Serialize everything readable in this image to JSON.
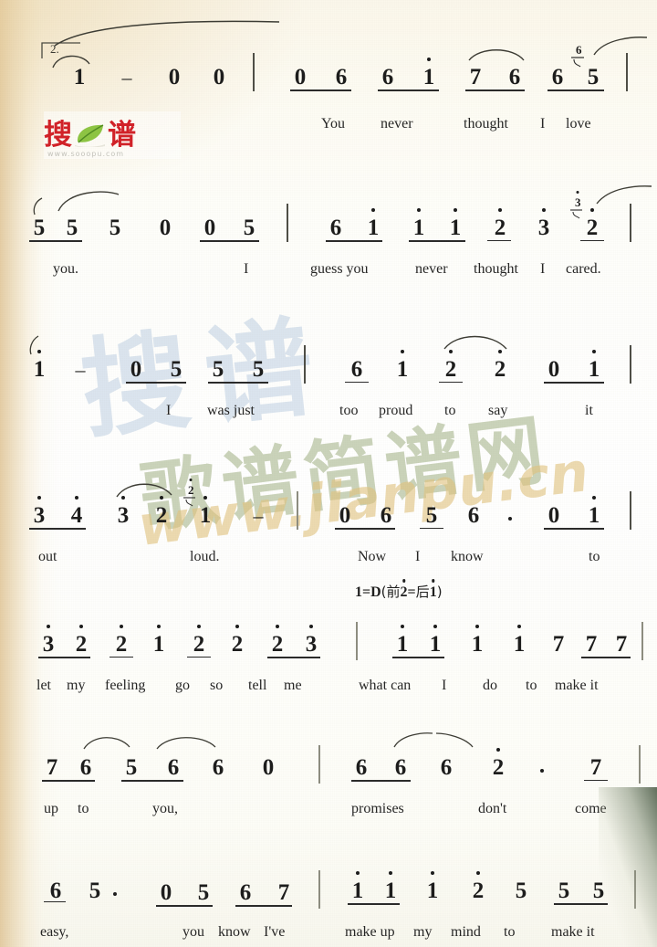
{
  "document": {
    "type": "jianpu-sheet-music",
    "notation": "Chinese numbered musical notation (简谱)",
    "page_background": "#fdfdf8",
    "ink_color": "#1c1c1c"
  },
  "logo": {
    "char1": "搜",
    "char2": "谱",
    "url": "www.sooopu.com",
    "red": "#d81f27",
    "leaf_green": "#7ab648",
    "icon": "leaf-icon"
  },
  "watermarks": {
    "chinese": "歌谱简谱网",
    "url": "www.jianpu.cn",
    "blue_char": "搜谱",
    "green": "#96a874",
    "tan": "#e2c47c",
    "blue": "#96b2d2"
  },
  "repeat_marking": {
    "label": "2."
  },
  "key_signature": {
    "text_prefix": "1=D",
    "paren_open": "(",
    "before_label": "前",
    "before_note": "2",
    "equals": "=",
    "after_label": "后",
    "after_note": "1",
    "paren_close": ")"
  },
  "systems": [
    {
      "index": 1,
      "measures": [
        {
          "notes": [
            {
              "n": "1",
              "oct": 0
            },
            {
              "n": "–",
              "dash": true
            },
            {
              "n": "0",
              "oct": 0
            },
            {
              "n": "0",
              "oct": 0
            }
          ]
        },
        {
          "notes": [
            {
              "n": "0",
              "oct": 0,
              "beam": 1
            },
            {
              "n": "6",
              "oct": 0,
              "beam": 1
            },
            {
              "n": "6",
              "oct": 0,
              "beam": 1
            },
            {
              "n": "1",
              "oct": 1,
              "beam": 1
            },
            {
              "n": "7",
              "oct": 0,
              "beam": 1
            },
            {
              "n": "6",
              "oct": 0,
              "beam": 1
            },
            {
              "n": "6",
              "oct": 0,
              "beam": 1
            },
            {
              "n": "5",
              "oct": 0,
              "beam": 1,
              "grace": "6"
            }
          ]
        }
      ],
      "lyrics": [
        "You",
        "never",
        "thought",
        "I",
        "love"
      ]
    },
    {
      "index": 2,
      "measures": [
        {
          "notes": [
            {
              "n": "5",
              "oct": 0,
              "beam": 1
            },
            {
              "n": "5",
              "oct": 0,
              "beam": 1
            },
            {
              "n": "5",
              "oct": 0
            },
            {
              "n": "0",
              "oct": 0
            },
            {
              "n": "0",
              "oct": 0,
              "beam": 1
            },
            {
              "n": "5",
              "oct": 0,
              "beam": 1
            }
          ]
        },
        {
          "notes": [
            {
              "n": "6",
              "oct": 0,
              "beam": 1
            },
            {
              "n": "1",
              "oct": 1,
              "beam": 1
            },
            {
              "n": "1",
              "oct": 1,
              "beam": 1
            },
            {
              "n": "1",
              "oct": 1,
              "beam": 1
            },
            {
              "n": "2",
              "oct": 1
            },
            {
              "n": "3",
              "oct": 1
            },
            {
              "n": "2",
              "oct": 1,
              "grace": "3"
            }
          ]
        }
      ],
      "lyrics": [
        "you.",
        "I",
        "guess you",
        "never",
        "thought",
        "I",
        "cared."
      ]
    },
    {
      "index": 3,
      "measures": [
        {
          "notes": [
            {
              "n": "1",
              "oct": 1
            },
            {
              "n": "–",
              "dash": true
            },
            {
              "n": "0",
              "oct": 0,
              "beam": 1
            },
            {
              "n": "5",
              "oct": 0,
              "beam": 1
            },
            {
              "n": "5",
              "oct": 0,
              "beam": 1
            },
            {
              "n": "5",
              "oct": 0,
              "beam": 1
            }
          ]
        },
        {
          "notes": [
            {
              "n": "6",
              "oct": 0,
              "beam": 1
            },
            {
              "n": "1",
              "oct": 1
            },
            {
              "n": "2",
              "oct": 1,
              "beam": 1
            },
            {
              "n": "2",
              "oct": 1
            },
            {
              "n": "0",
              "oct": 0,
              "beam": 1
            },
            {
              "n": "1",
              "oct": 1,
              "beam": 1
            }
          ]
        }
      ],
      "lyrics": [
        "I",
        "was just",
        "too",
        "proud",
        "to",
        "say",
        "it"
      ]
    },
    {
      "index": 4,
      "measures": [
        {
          "notes": [
            {
              "n": "3",
              "oct": 1,
              "beam": 1
            },
            {
              "n": "4",
              "oct": 1,
              "beam": 1
            },
            {
              "n": "3",
              "oct": 1
            },
            {
              "n": "2",
              "oct": 1
            },
            {
              "n": "1",
              "oct": 1,
              "grace": "2"
            },
            {
              "n": "–",
              "dash": true
            }
          ]
        },
        {
          "notes": [
            {
              "n": "0",
              "oct": 0,
              "beam": 1
            },
            {
              "n": "6",
              "oct": 0,
              "beam": 1
            },
            {
              "n": "5",
              "oct": 0,
              "beam": 1
            },
            {
              "n": "6",
              "oct": 0,
              "aug": true
            },
            {
              "n": "0",
              "oct": 0,
              "beam": 1
            },
            {
              "n": "1",
              "oct": 1,
              "beam": 1
            }
          ]
        }
      ],
      "lyrics": [
        "out",
        "loud.",
        "Now",
        "I",
        "know",
        "to"
      ]
    },
    {
      "index": 5,
      "measures": [
        {
          "notes": [
            {
              "n": "3",
              "oct": 1,
              "beam": 1
            },
            {
              "n": "2",
              "oct": 1,
              "beam": 1
            },
            {
              "n": "2",
              "oct": 1,
              "beam": 1
            },
            {
              "n": "1",
              "oct": 1
            },
            {
              "n": "2",
              "oct": 1,
              "beam": 1
            },
            {
              "n": "2",
              "oct": 1
            },
            {
              "n": "2",
              "oct": 1,
              "beam": 1
            },
            {
              "n": "3",
              "oct": 1,
              "beam": 1
            }
          ]
        },
        {
          "notes": [
            {
              "n": "1",
              "oct": 1,
              "beam": 1
            },
            {
              "n": "1",
              "oct": 1,
              "beam": 1
            },
            {
              "n": "1",
              "oct": 1
            },
            {
              "n": "1",
              "oct": 1
            },
            {
              "n": "7",
              "oct": 0
            },
            {
              "n": "7",
              "oct": 0,
              "beam": 1
            },
            {
              "n": "7",
              "oct": 0,
              "beam": 1
            }
          ]
        }
      ],
      "lyrics": [
        "let",
        "my",
        "feeling",
        "go",
        "so",
        "tell",
        "me",
        "what can",
        "I",
        "do",
        "to",
        "make it"
      ]
    },
    {
      "index": 6,
      "measures": [
        {
          "notes": [
            {
              "n": "7",
              "oct": 0,
              "beam": 1
            },
            {
              "n": "6",
              "oct": 0,
              "beam": 1
            },
            {
              "n": "5",
              "oct": 0
            },
            {
              "n": "6",
              "oct": 0,
              "beam": 1
            },
            {
              "n": "6",
              "oct": 0
            },
            {
              "n": "0",
              "oct": 0
            }
          ]
        },
        {
          "notes": [
            {
              "n": "6",
              "oct": 0,
              "beam": 1
            },
            {
              "n": "6",
              "oct": 0,
              "beam": 1
            },
            {
              "n": "6",
              "oct": 0
            },
            {
              "n": "2",
              "oct": 1,
              "aug": true
            },
            {
              "n": "7",
              "oct": 0,
              "beam": 1
            }
          ]
        }
      ],
      "lyrics": [
        "up",
        "to",
        "you,",
        "promises",
        "don't",
        "come"
      ]
    },
    {
      "index": 7,
      "measures": [
        {
          "notes": [
            {
              "n": "6",
              "oct": 0,
              "beam": 1
            },
            {
              "n": "5",
              "oct": 0,
              "aug": true
            },
            {
              "n": "0",
              "oct": 0,
              "beam": 1
            },
            {
              "n": "5",
              "oct": 0,
              "beam": 1
            },
            {
              "n": "6",
              "oct": 0,
              "beam": 1
            },
            {
              "n": "7",
              "oct": 0,
              "beam": 1
            }
          ]
        },
        {
          "notes": [
            {
              "n": "1",
              "oct": 1,
              "beam": 1
            },
            {
              "n": "1",
              "oct": 1,
              "beam": 1
            },
            {
              "n": "1",
              "oct": 1
            },
            {
              "n": "2",
              "oct": 1
            },
            {
              "n": "5",
              "oct": 0
            },
            {
              "n": "5",
              "oct": 0,
              "beam": 1
            },
            {
              "n": "5",
              "oct": 0,
              "beam": 1
            }
          ]
        }
      ],
      "lyrics": [
        "easy,",
        "you",
        "know",
        "I've",
        "make up",
        "my",
        "mind",
        "to",
        "make it"
      ]
    }
  ]
}
